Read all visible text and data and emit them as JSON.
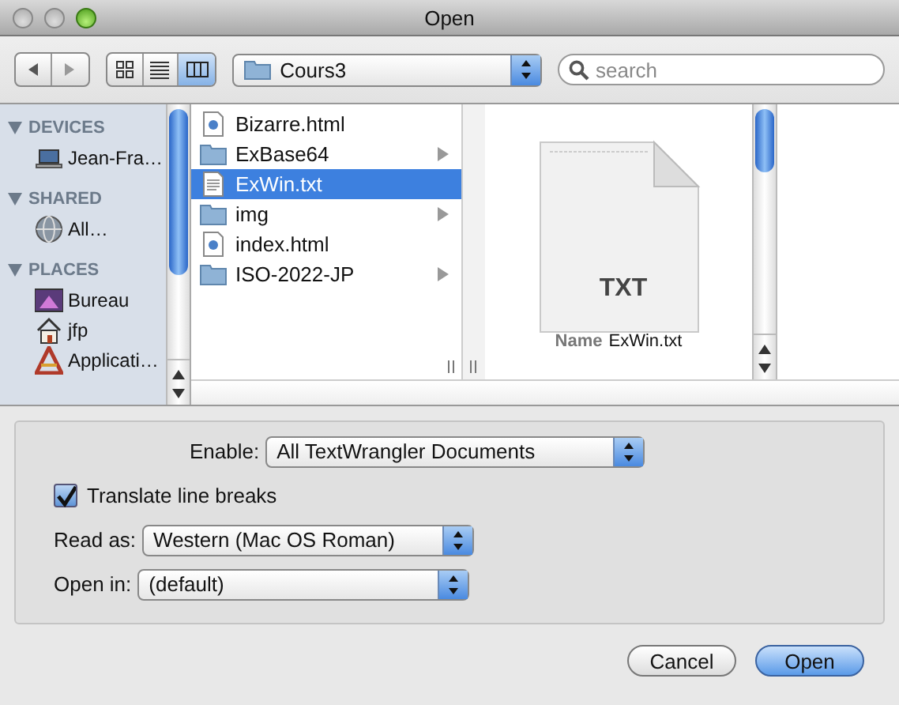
{
  "window": {
    "title": "Open"
  },
  "toolbar": {
    "view_modes": [
      {
        "kind": "icons",
        "selected": false
      },
      {
        "kind": "list",
        "selected": false
      },
      {
        "kind": "columns",
        "selected": true
      }
    ],
    "location": "Cours3",
    "search": {
      "placeholder": "search"
    }
  },
  "sidebar": [
    {
      "title": "DEVICES",
      "expanded": true,
      "items": [
        {
          "kind": "laptop",
          "label": "Jean-Fra…"
        }
      ]
    },
    {
      "title": "SHARED",
      "expanded": true,
      "items": [
        {
          "kind": "network",
          "label": "All…"
        }
      ]
    },
    {
      "title": "PLACES",
      "expanded": true,
      "items": [
        {
          "kind": "desktop",
          "label": "Bureau"
        },
        {
          "kind": "home",
          "label": "jfp"
        },
        {
          "kind": "apps",
          "label": "Applicati…"
        }
      ]
    }
  ],
  "files": [
    {
      "kind": "html",
      "name": "Bizarre.html",
      "selected": false
    },
    {
      "kind": "folder",
      "name": "ExBase64",
      "selected": false
    },
    {
      "kind": "text",
      "name": "ExWin.txt",
      "selected": true
    },
    {
      "kind": "folder",
      "name": "img",
      "selected": false
    },
    {
      "kind": "html",
      "name": "index.html",
      "selected": false
    },
    {
      "kind": "folder",
      "name": "ISO-2022-JP",
      "selected": false
    }
  ],
  "preview": {
    "badge": "TXT",
    "name_label": "Name",
    "name": "ExWin.txt"
  },
  "options": {
    "enable": {
      "label": "Enable:",
      "value": "All TextWrangler Documents"
    },
    "translate": {
      "label": "Translate line breaks",
      "checked": true
    },
    "read_as": {
      "label": "Read as:",
      "value": "Western (Mac OS Roman)"
    },
    "open_in": {
      "label": "Open in:",
      "value": "(default)"
    }
  },
  "buttons": [
    {
      "label": "Cancel",
      "default": false
    },
    {
      "label": "Open",
      "default": true
    }
  ]
}
